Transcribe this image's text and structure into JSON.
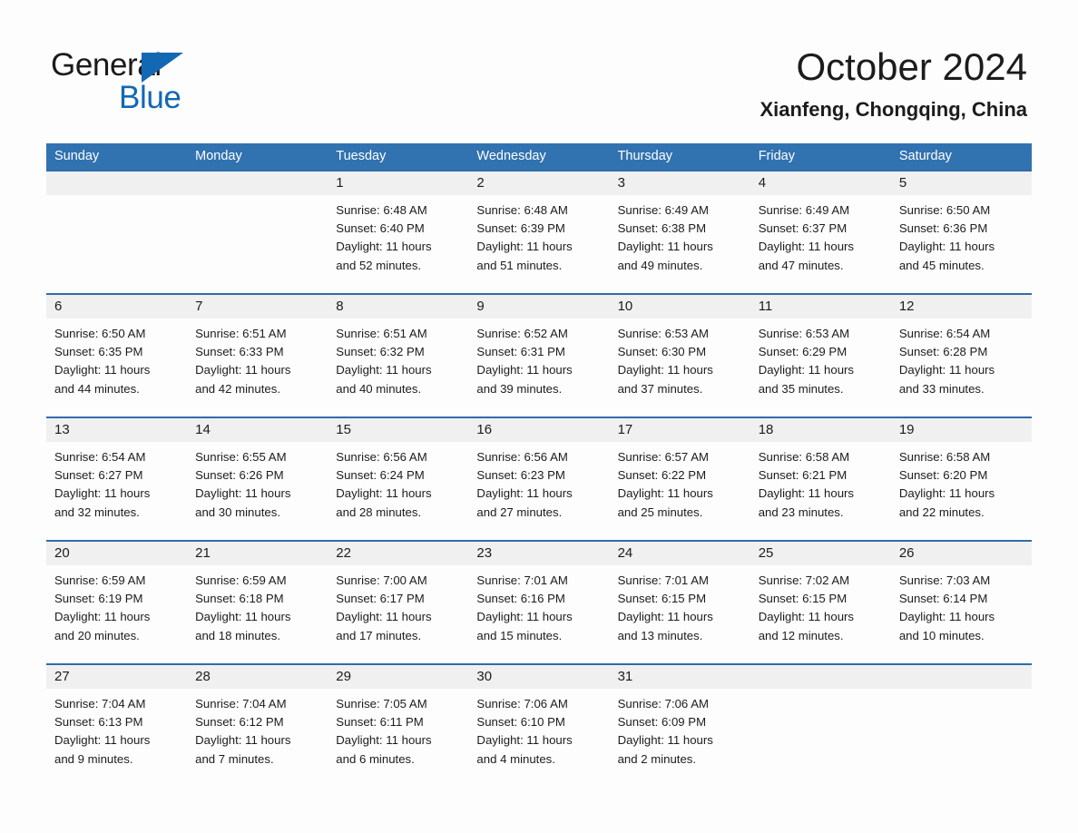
{
  "brand": {
    "name_part1": "General",
    "name_part2": "Blue",
    "triangle_icon": "triangle-icon",
    "accent_color": "#1268b3"
  },
  "header": {
    "title": "October 2024",
    "subtitle": "Xianfeng, Chongqing, China"
  },
  "colors": {
    "header_blue": "#3172b0",
    "row_separator_blue": "#2f6da8",
    "daynum_band_gray": "#f0f0f0",
    "page_background": "#fdfdfd",
    "text": "#1c1c1c"
  },
  "weekdays": [
    "Sunday",
    "Monday",
    "Tuesday",
    "Wednesday",
    "Thursday",
    "Friday",
    "Saturday"
  ],
  "weeks": [
    {
      "days": [
        {
          "num": "",
          "sunrise": "",
          "sunset": "",
          "daylight_1": "",
          "daylight_2": ""
        },
        {
          "num": "",
          "sunrise": "",
          "sunset": "",
          "daylight_1": "",
          "daylight_2": ""
        },
        {
          "num": "1",
          "sunrise": "Sunrise: 6:48 AM",
          "sunset": "Sunset: 6:40 PM",
          "daylight_1": "Daylight: 11 hours",
          "daylight_2": "and 52 minutes."
        },
        {
          "num": "2",
          "sunrise": "Sunrise: 6:48 AM",
          "sunset": "Sunset: 6:39 PM",
          "daylight_1": "Daylight: 11 hours",
          "daylight_2": "and 51 minutes."
        },
        {
          "num": "3",
          "sunrise": "Sunrise: 6:49 AM",
          "sunset": "Sunset: 6:38 PM",
          "daylight_1": "Daylight: 11 hours",
          "daylight_2": "and 49 minutes."
        },
        {
          "num": "4",
          "sunrise": "Sunrise: 6:49 AM",
          "sunset": "Sunset: 6:37 PM",
          "daylight_1": "Daylight: 11 hours",
          "daylight_2": "and 47 minutes."
        },
        {
          "num": "5",
          "sunrise": "Sunrise: 6:50 AM",
          "sunset": "Sunset: 6:36 PM",
          "daylight_1": "Daylight: 11 hours",
          "daylight_2": "and 45 minutes."
        }
      ]
    },
    {
      "days": [
        {
          "num": "6",
          "sunrise": "Sunrise: 6:50 AM",
          "sunset": "Sunset: 6:35 PM",
          "daylight_1": "Daylight: 11 hours",
          "daylight_2": "and 44 minutes."
        },
        {
          "num": "7",
          "sunrise": "Sunrise: 6:51 AM",
          "sunset": "Sunset: 6:33 PM",
          "daylight_1": "Daylight: 11 hours",
          "daylight_2": "and 42 minutes."
        },
        {
          "num": "8",
          "sunrise": "Sunrise: 6:51 AM",
          "sunset": "Sunset: 6:32 PM",
          "daylight_1": "Daylight: 11 hours",
          "daylight_2": "and 40 minutes."
        },
        {
          "num": "9",
          "sunrise": "Sunrise: 6:52 AM",
          "sunset": "Sunset: 6:31 PM",
          "daylight_1": "Daylight: 11 hours",
          "daylight_2": "and 39 minutes."
        },
        {
          "num": "10",
          "sunrise": "Sunrise: 6:53 AM",
          "sunset": "Sunset: 6:30 PM",
          "daylight_1": "Daylight: 11 hours",
          "daylight_2": "and 37 minutes."
        },
        {
          "num": "11",
          "sunrise": "Sunrise: 6:53 AM",
          "sunset": "Sunset: 6:29 PM",
          "daylight_1": "Daylight: 11 hours",
          "daylight_2": "and 35 minutes."
        },
        {
          "num": "12",
          "sunrise": "Sunrise: 6:54 AM",
          "sunset": "Sunset: 6:28 PM",
          "daylight_1": "Daylight: 11 hours",
          "daylight_2": "and 33 minutes."
        }
      ]
    },
    {
      "days": [
        {
          "num": "13",
          "sunrise": "Sunrise: 6:54 AM",
          "sunset": "Sunset: 6:27 PM",
          "daylight_1": "Daylight: 11 hours",
          "daylight_2": "and 32 minutes."
        },
        {
          "num": "14",
          "sunrise": "Sunrise: 6:55 AM",
          "sunset": "Sunset: 6:26 PM",
          "daylight_1": "Daylight: 11 hours",
          "daylight_2": "and 30 minutes."
        },
        {
          "num": "15",
          "sunrise": "Sunrise: 6:56 AM",
          "sunset": "Sunset: 6:24 PM",
          "daylight_1": "Daylight: 11 hours",
          "daylight_2": "and 28 minutes."
        },
        {
          "num": "16",
          "sunrise": "Sunrise: 6:56 AM",
          "sunset": "Sunset: 6:23 PM",
          "daylight_1": "Daylight: 11 hours",
          "daylight_2": "and 27 minutes."
        },
        {
          "num": "17",
          "sunrise": "Sunrise: 6:57 AM",
          "sunset": "Sunset: 6:22 PM",
          "daylight_1": "Daylight: 11 hours",
          "daylight_2": "and 25 minutes."
        },
        {
          "num": "18",
          "sunrise": "Sunrise: 6:58 AM",
          "sunset": "Sunset: 6:21 PM",
          "daylight_1": "Daylight: 11 hours",
          "daylight_2": "and 23 minutes."
        },
        {
          "num": "19",
          "sunrise": "Sunrise: 6:58 AM",
          "sunset": "Sunset: 6:20 PM",
          "daylight_1": "Daylight: 11 hours",
          "daylight_2": "and 22 minutes."
        }
      ]
    },
    {
      "days": [
        {
          "num": "20",
          "sunrise": "Sunrise: 6:59 AM",
          "sunset": "Sunset: 6:19 PM",
          "daylight_1": "Daylight: 11 hours",
          "daylight_2": "and 20 minutes."
        },
        {
          "num": "21",
          "sunrise": "Sunrise: 6:59 AM",
          "sunset": "Sunset: 6:18 PM",
          "daylight_1": "Daylight: 11 hours",
          "daylight_2": "and 18 minutes."
        },
        {
          "num": "22",
          "sunrise": "Sunrise: 7:00 AM",
          "sunset": "Sunset: 6:17 PM",
          "daylight_1": "Daylight: 11 hours",
          "daylight_2": "and 17 minutes."
        },
        {
          "num": "23",
          "sunrise": "Sunrise: 7:01 AM",
          "sunset": "Sunset: 6:16 PM",
          "daylight_1": "Daylight: 11 hours",
          "daylight_2": "and 15 minutes."
        },
        {
          "num": "24",
          "sunrise": "Sunrise: 7:01 AM",
          "sunset": "Sunset: 6:15 PM",
          "daylight_1": "Daylight: 11 hours",
          "daylight_2": "and 13 minutes."
        },
        {
          "num": "25",
          "sunrise": "Sunrise: 7:02 AM",
          "sunset": "Sunset: 6:15 PM",
          "daylight_1": "Daylight: 11 hours",
          "daylight_2": "and 12 minutes."
        },
        {
          "num": "26",
          "sunrise": "Sunrise: 7:03 AM",
          "sunset": "Sunset: 6:14 PM",
          "daylight_1": "Daylight: 11 hours",
          "daylight_2": "and 10 minutes."
        }
      ]
    },
    {
      "days": [
        {
          "num": "27",
          "sunrise": "Sunrise: 7:04 AM",
          "sunset": "Sunset: 6:13 PM",
          "daylight_1": "Daylight: 11 hours",
          "daylight_2": "and 9 minutes."
        },
        {
          "num": "28",
          "sunrise": "Sunrise: 7:04 AM",
          "sunset": "Sunset: 6:12 PM",
          "daylight_1": "Daylight: 11 hours",
          "daylight_2": "and 7 minutes."
        },
        {
          "num": "29",
          "sunrise": "Sunrise: 7:05 AM",
          "sunset": "Sunset: 6:11 PM",
          "daylight_1": "Daylight: 11 hours",
          "daylight_2": "and 6 minutes."
        },
        {
          "num": "30",
          "sunrise": "Sunrise: 7:06 AM",
          "sunset": "Sunset: 6:10 PM",
          "daylight_1": "Daylight: 11 hours",
          "daylight_2": "and 4 minutes."
        },
        {
          "num": "31",
          "sunrise": "Sunrise: 7:06 AM",
          "sunset": "Sunset: 6:09 PM",
          "daylight_1": "Daylight: 11 hours",
          "daylight_2": "and 2 minutes."
        },
        {
          "num": "",
          "sunrise": "",
          "sunset": "",
          "daylight_1": "",
          "daylight_2": ""
        },
        {
          "num": "",
          "sunrise": "",
          "sunset": "",
          "daylight_1": "",
          "daylight_2": ""
        }
      ]
    }
  ]
}
